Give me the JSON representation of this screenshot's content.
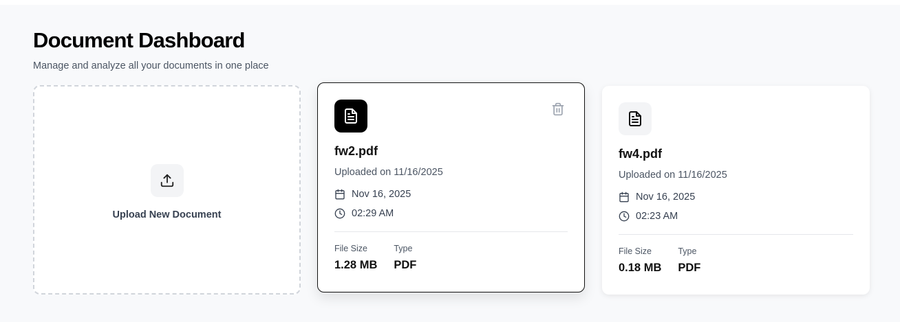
{
  "header": {
    "title": "Document Dashboard",
    "subtitle": "Manage and analyze all your documents in one place"
  },
  "upload": {
    "label": "Upload New Document",
    "icon": "upload-icon"
  },
  "documents": [
    {
      "name": "fw2.pdf",
      "uploaded": "Uploaded on 11/16/2025",
      "date": "Nov 16, 2025",
      "time": "02:29 AM",
      "size_label": "File Size",
      "size": "1.28 MB",
      "type_label": "Type",
      "type": "PDF",
      "selected": true
    },
    {
      "name": "fw4.pdf",
      "uploaded": "Uploaded on 11/16/2025",
      "date": "Nov 16, 2025",
      "time": "02:23 AM",
      "size_label": "File Size",
      "size": "0.18 MB",
      "type_label": "Type",
      "type": "PDF",
      "selected": false
    }
  ],
  "colors": {
    "background": "#f8f9fb",
    "selected_border": "#111111",
    "muted_text": "#4b5563"
  }
}
